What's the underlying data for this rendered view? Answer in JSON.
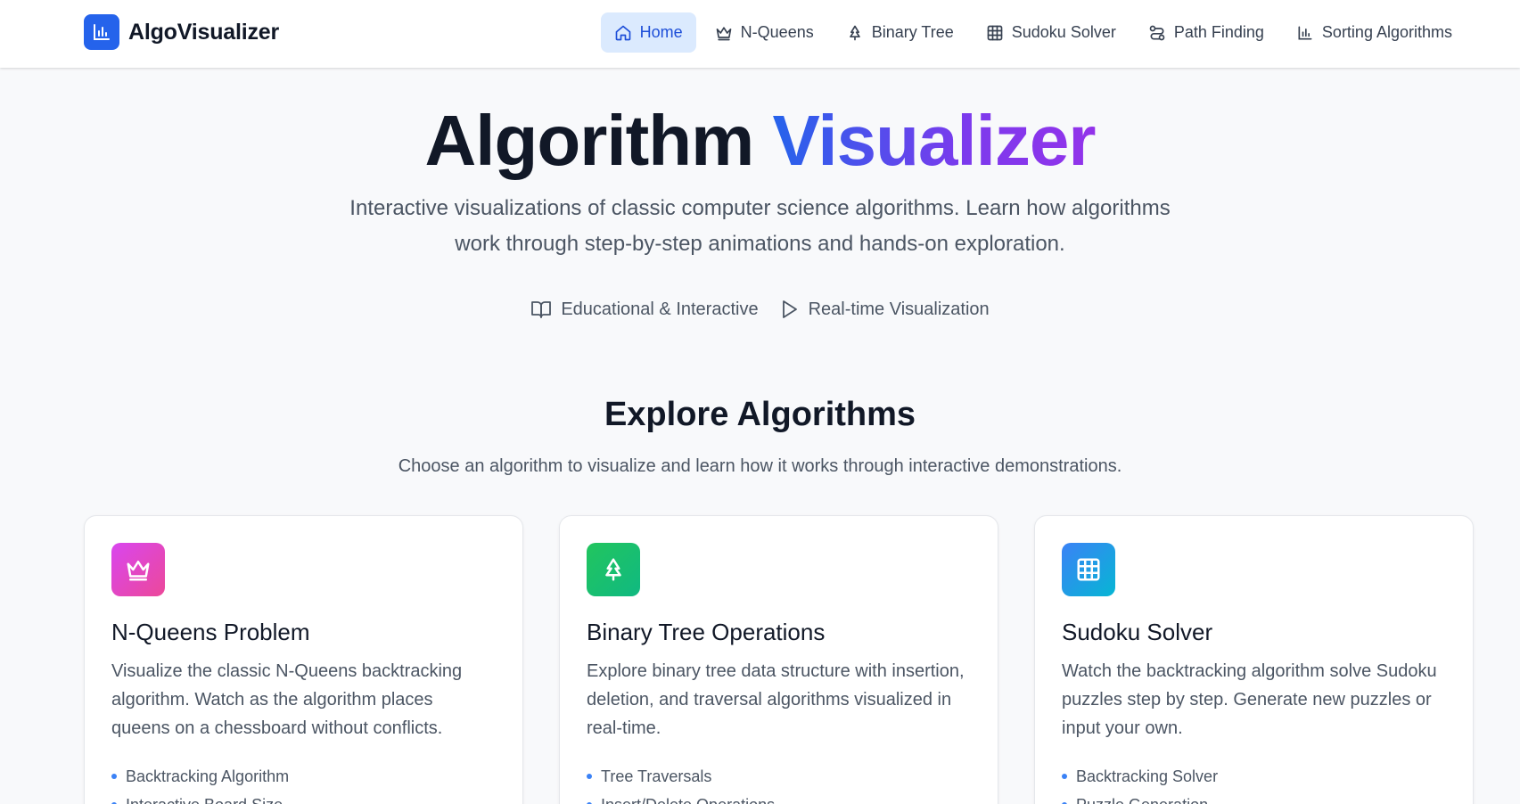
{
  "header": {
    "brand": "AlgoVisualizer",
    "nav": [
      {
        "label": "Home",
        "icon": "home-icon",
        "active": true
      },
      {
        "label": "N-Queens",
        "icon": "crown-icon"
      },
      {
        "label": "Binary Tree",
        "icon": "tree-icon"
      },
      {
        "label": "Sudoku Solver",
        "icon": "grid-icon"
      },
      {
        "label": "Path Finding",
        "icon": "route-icon"
      },
      {
        "label": "Sorting Algorithms",
        "icon": "bar-chart-icon"
      }
    ]
  },
  "hero": {
    "title_main": "Algorithm",
    "title_accent": "Visualizer",
    "subtitle": "Interactive visualizations of classic computer science algorithms. Learn how algorithms work through step-by-step animations and hands-on exploration.",
    "tags": [
      {
        "label": "Educational & Interactive",
        "icon": "book-open-icon"
      },
      {
        "label": "Real-time Visualization",
        "icon": "play-icon"
      }
    ]
  },
  "explore": {
    "title": "Explore Algorithms",
    "subtitle": "Choose an algorithm to visualize and learn how it works through interactive demonstrations."
  },
  "cards": [
    {
      "title": "N-Queens Problem",
      "icon": "crown-icon",
      "color_from": "#d946ef",
      "color_to": "#ec4899",
      "description": "Visualize the classic N-Queens backtracking algorithm. Watch as the algorithm places queens on a chessboard without conflicts.",
      "features": [
        "Backtracking Algorithm",
        "Interactive Board Size"
      ]
    },
    {
      "title": "Binary Tree Operations",
      "icon": "tree-icon",
      "color_from": "#22c55e",
      "color_to": "#10b981",
      "description": "Explore binary tree data structure with insertion, deletion, and traversal algorithms visualized in real-time.",
      "features": [
        "Tree Traversals",
        "Insert/Delete Operations"
      ]
    },
    {
      "title": "Sudoku Solver",
      "icon": "grid-icon",
      "color_from": "#3b82f6",
      "color_to": "#06b6d4",
      "description": "Watch the backtracking algorithm solve Sudoku puzzles step by step. Generate new puzzles or input your own.",
      "features": [
        "Backtracking Solver",
        "Puzzle Generation"
      ]
    }
  ],
  "colors": {
    "brand": "#2563eb",
    "nav_active_bg": "#dbeafe",
    "bullet": "#3b82f6"
  }
}
